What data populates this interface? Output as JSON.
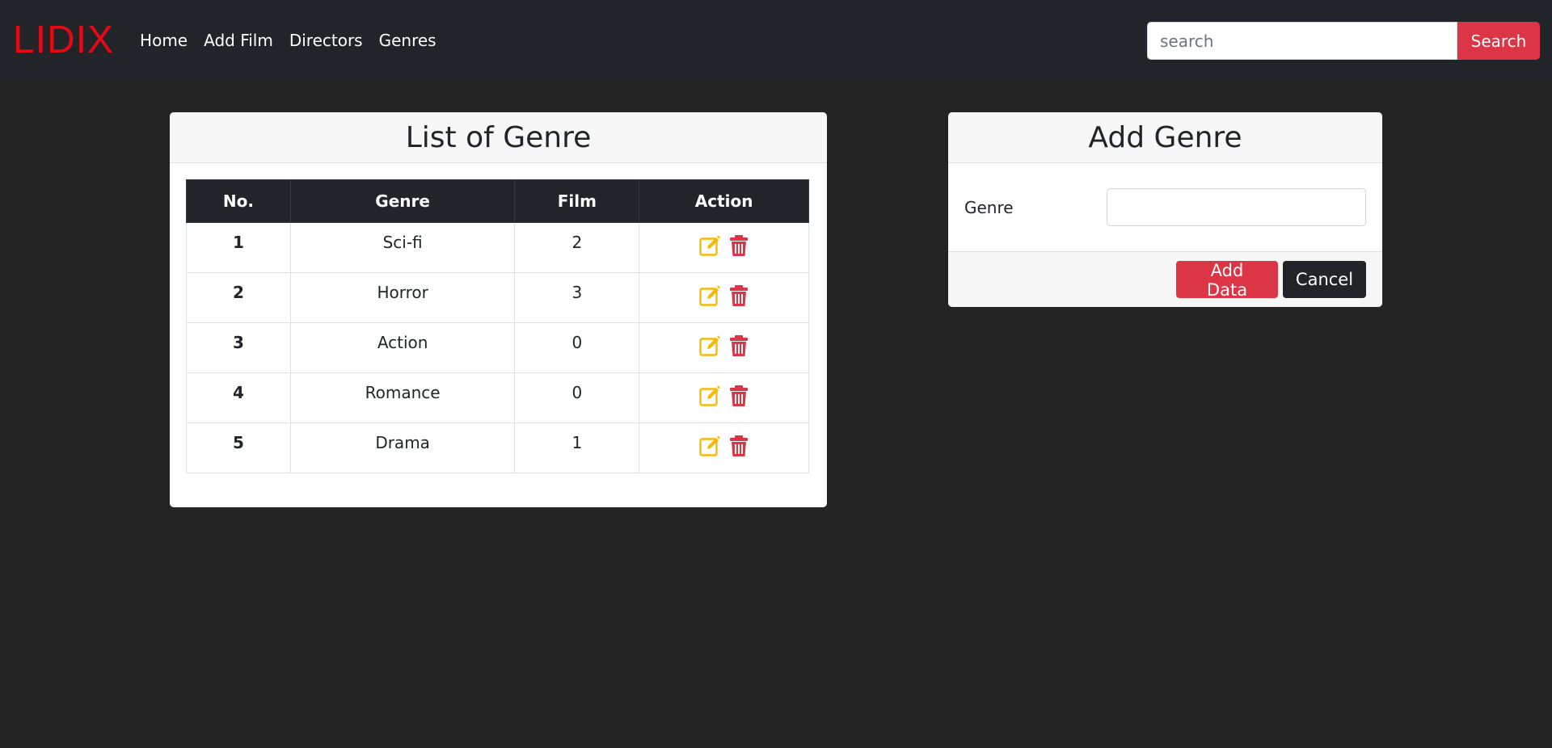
{
  "navbar": {
    "brand": "LIDIX",
    "links": [
      "Home",
      "Add Film",
      "Directors",
      "Genres"
    ],
    "search_placeholder": "search",
    "search_button": "Search"
  },
  "list_card": {
    "title": "List of Genre",
    "columns": [
      "No.",
      "Genre",
      "Film",
      "Action"
    ],
    "rows": [
      {
        "no": "1",
        "genre": "Sci-fi",
        "film": "2"
      },
      {
        "no": "2",
        "genre": "Horror",
        "film": "3"
      },
      {
        "no": "3",
        "genre": "Action",
        "film": "0"
      },
      {
        "no": "4",
        "genre": "Romance",
        "film": "0"
      },
      {
        "no": "5",
        "genre": "Drama",
        "film": "1"
      }
    ],
    "edit_icon": "edit-icon",
    "delete_icon": "trash-icon"
  },
  "add_card": {
    "title": "Add Genre",
    "genre_label": "Genre",
    "genre_value": "",
    "add_button": "Add Data",
    "cancel_button": "Cancel"
  },
  "colors": {
    "brand": "#e50914",
    "navbar": "#212529",
    "background": "#242424",
    "accent": "#dc3545",
    "edit_icon": "#f5b90a",
    "delete_icon": "#dc3545"
  }
}
